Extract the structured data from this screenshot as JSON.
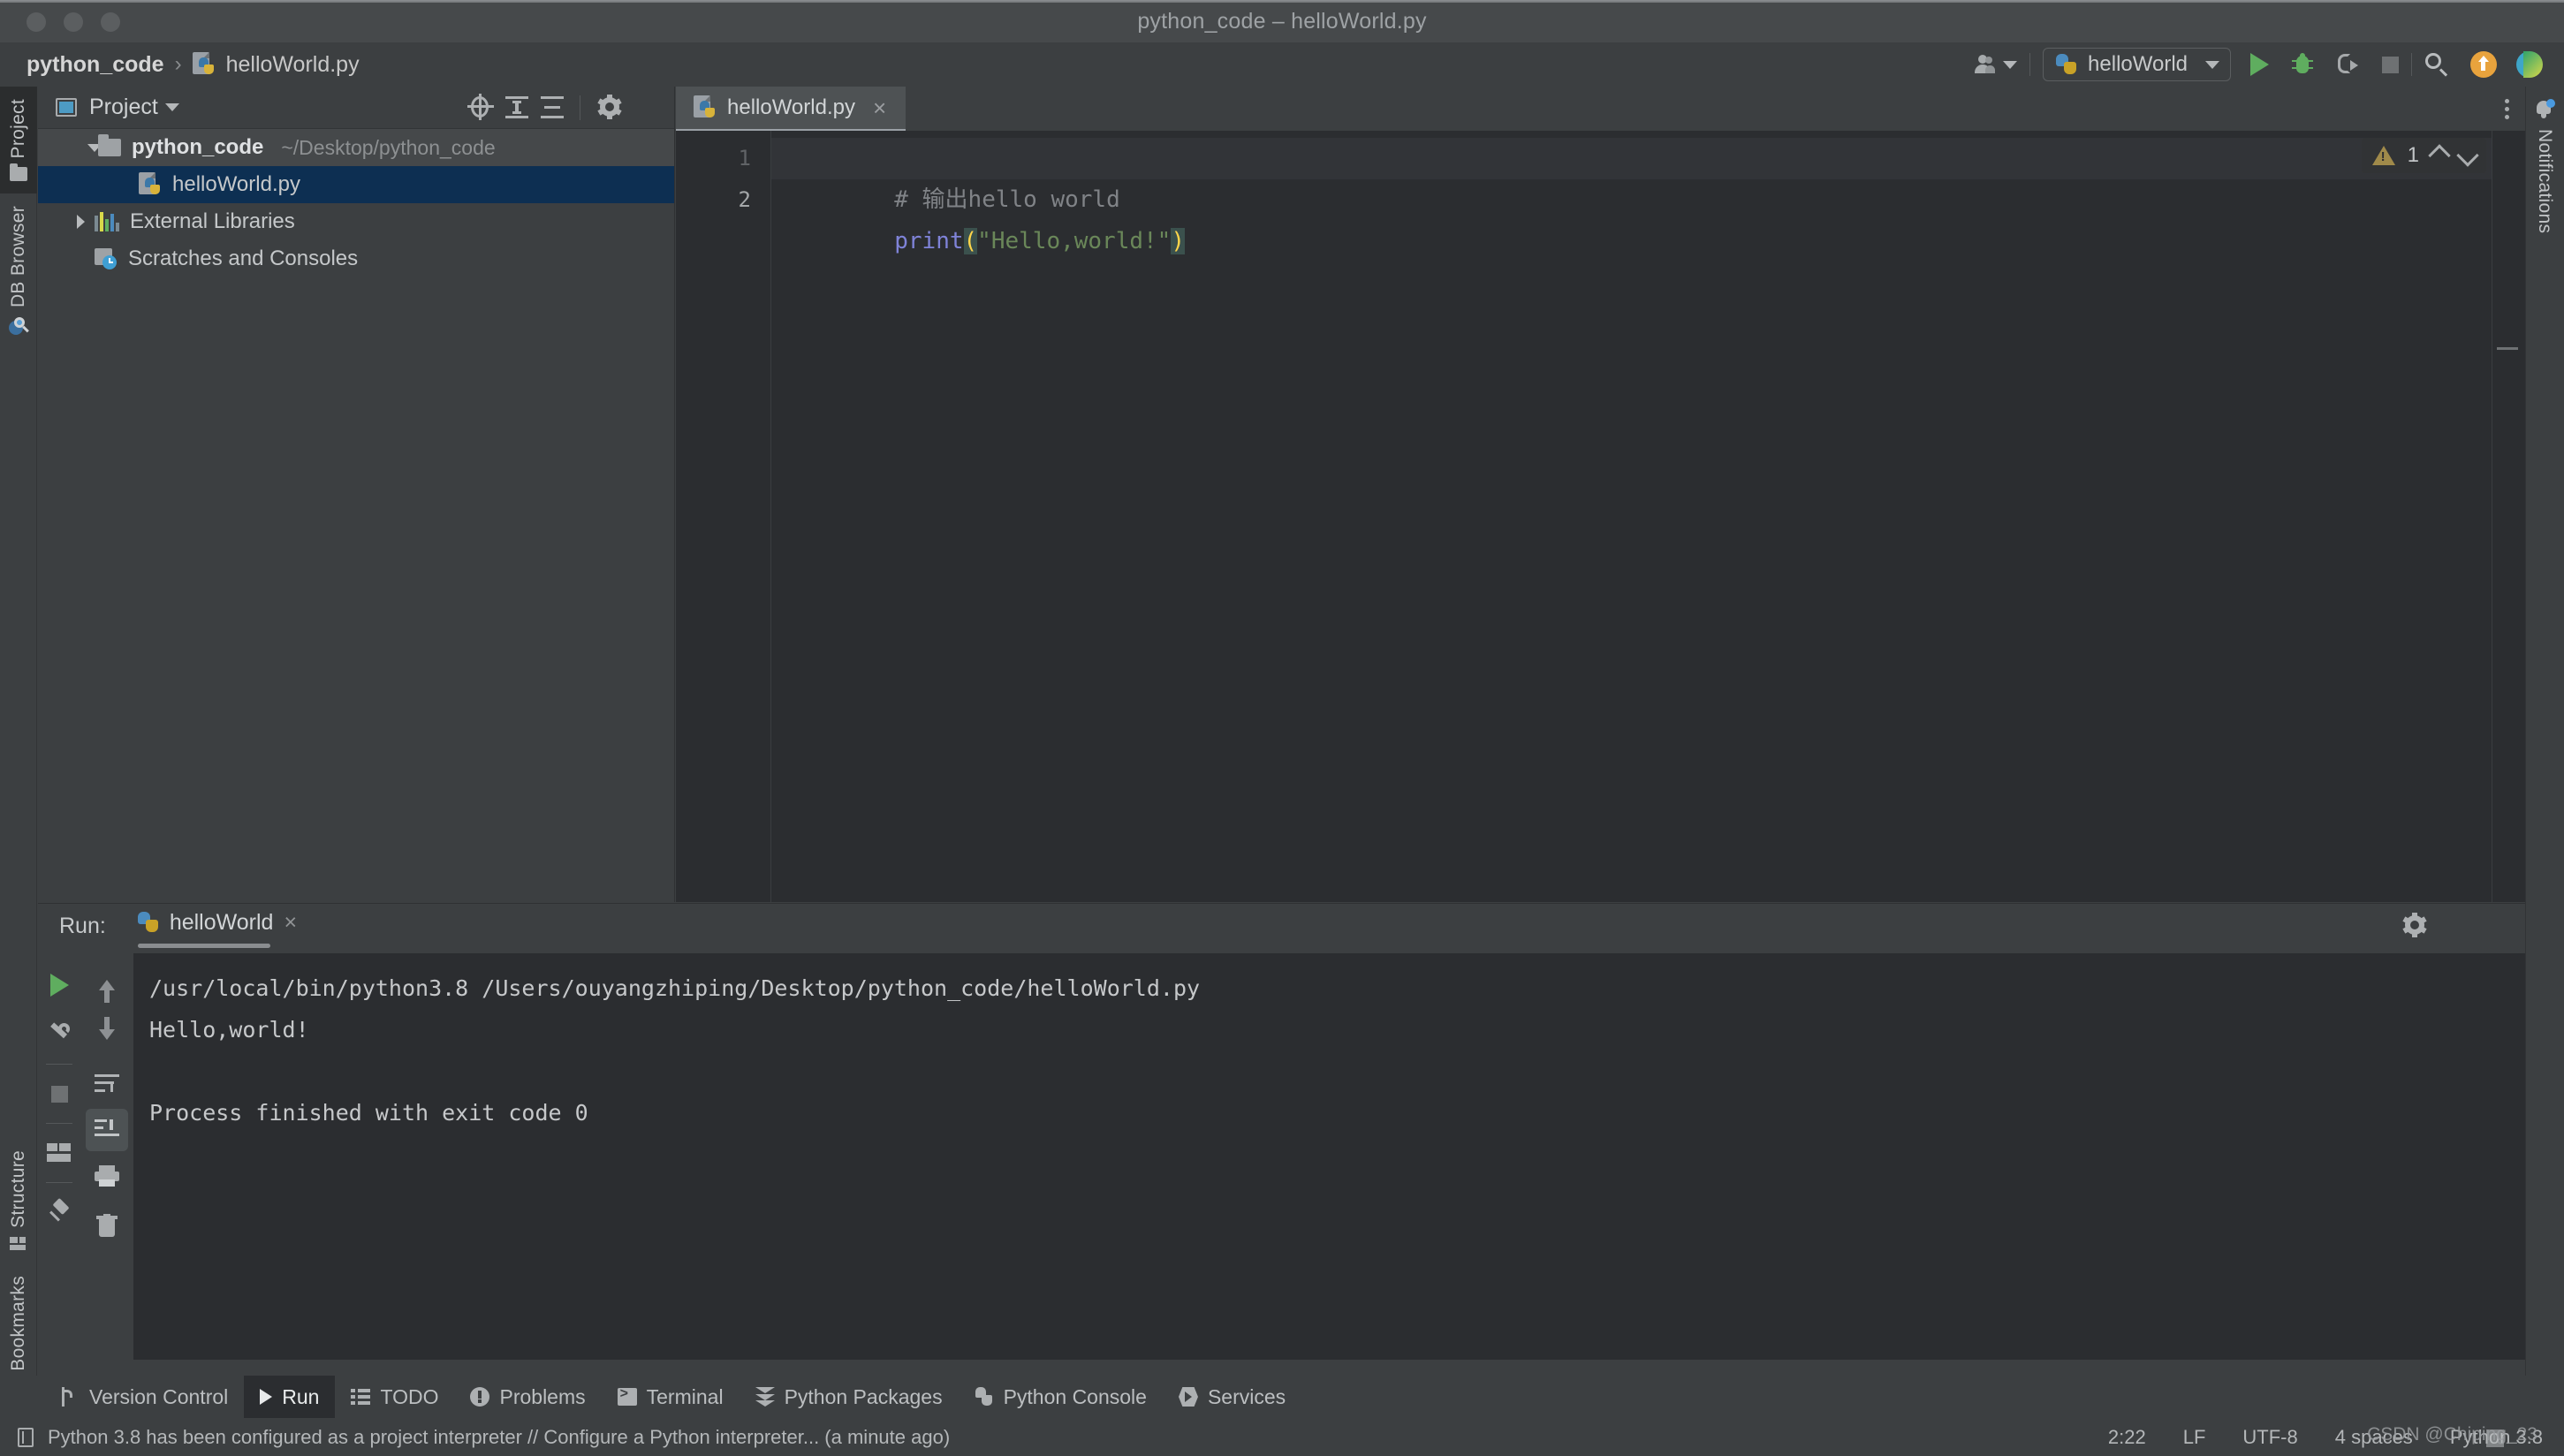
{
  "window": {
    "title": "python_code – helloWorld.py",
    "traffic_lights": [
      "close",
      "minimize",
      "zoom"
    ]
  },
  "breadcrumb": {
    "project": "python_code",
    "separator": "›",
    "file": "helloWorld.py",
    "file_icon": "python-file-icon"
  },
  "top_toolbar": {
    "user_icon": "user-avatar-icon",
    "user_caret": "chevron-down-icon",
    "run_config": {
      "icon": "python-icon",
      "name": "helloWorld",
      "caret": "chevron-down-icon"
    },
    "buttons": [
      {
        "name": "run-button",
        "icon": "play-icon",
        "color": "#5fad5f"
      },
      {
        "name": "debug-button",
        "icon": "bug-icon",
        "color": "#5fad5f"
      },
      {
        "name": "run-coverage-button",
        "icon": "coverage-icon",
        "color": "#a6a9ab"
      },
      {
        "name": "stop-button",
        "icon": "stop-square-icon",
        "color": "#6e7173"
      },
      {
        "name": "search-everywhere-button",
        "icon": "search-icon",
        "color": "#b9bcbe"
      },
      {
        "name": "update-project-button",
        "icon": "arrow-up-circle-icon",
        "color": "#e8a33d"
      },
      {
        "name": "ide-logo",
        "icon": "pycharm-logo-icon",
        "color": "#3ea6c9"
      }
    ]
  },
  "left_rail": {
    "top": [
      {
        "label": "Project",
        "icon": "folder-icon",
        "active": true
      },
      {
        "label": "DB Browser",
        "icon": "db-browser-icon",
        "active": false
      }
    ],
    "bottom": [
      {
        "label": "Structure",
        "icon": "structure-icon",
        "active": false
      },
      {
        "label": "Bookmarks",
        "icon": "bookmark-icon",
        "active": false
      }
    ]
  },
  "right_rail": {
    "items": [
      {
        "label": "Notifications",
        "icon": "bell-icon",
        "badge": true
      }
    ]
  },
  "project_panel": {
    "title": "Project",
    "title_caret": "chevron-down-icon",
    "header_icons": [
      {
        "name": "select-opened-file-button",
        "icon": "locate-icon"
      },
      {
        "name": "expand-all-button",
        "icon": "expand-all-icon"
      },
      {
        "name": "collapse-all-button",
        "icon": "collapse-all-icon"
      },
      {
        "name": "panel-settings-button",
        "icon": "gear-icon"
      },
      {
        "name": "hide-panel-button",
        "icon": "minus-icon"
      }
    ],
    "tree": [
      {
        "label": "python_code",
        "path": "~/Desktop/python_code",
        "icon": "folder-icon",
        "arrow": "chevron-down-icon",
        "kind": "root",
        "selected": false
      },
      {
        "label": "helloWorld.py",
        "path": "",
        "icon": "python-file-icon",
        "arrow": "",
        "kind": "file",
        "selected": true
      },
      {
        "label": "External Libraries",
        "path": "",
        "icon": "libraries-icon",
        "arrow": "chevron-right-icon",
        "kind": "node",
        "selected": false
      },
      {
        "label": "Scratches and Consoles",
        "path": "",
        "icon": "scratches-icon",
        "arrow": "",
        "kind": "node",
        "selected": false
      }
    ]
  },
  "editor": {
    "tab": {
      "label": "helloWorld.py",
      "icon": "python-file-icon",
      "close": "×"
    },
    "options_icon": "kebab-menu-icon",
    "inspection": {
      "warning_icon": "warning-triangle-icon",
      "count": "1",
      "prev": "chevron-up-icon",
      "next": "chevron-down-icon"
    },
    "lines": [
      {
        "number": "1",
        "tokens": [
          {
            "text": "# 输出hello world",
            "type": "comment"
          }
        ]
      },
      {
        "number": "2",
        "tokens": [
          {
            "text": "print",
            "type": "function"
          },
          {
            "text": "(",
            "type": "paren-highlight"
          },
          {
            "text": "\"Hello,world!\"",
            "type": "string"
          },
          {
            "text": ")",
            "type": "paren-highlight"
          }
        ]
      }
    ]
  },
  "run_panel": {
    "label": "Run:",
    "tab": {
      "label": "helloWorld",
      "icon": "python-icon",
      "close": "×"
    },
    "header_icons": [
      {
        "name": "run-settings-button",
        "icon": "gear-icon"
      },
      {
        "name": "hide-run-panel-button",
        "icon": "minus-icon"
      }
    ],
    "gutter_left": [
      {
        "name": "rerun-button",
        "icon": "play-icon",
        "active": false
      },
      {
        "name": "modify-run-configuration-button",
        "icon": "wrench-icon",
        "active": false
      },
      {
        "name": "stop-process-button",
        "icon": "stop-square-icon",
        "active": false
      },
      {
        "name": "layout-settings-button",
        "icon": "layout-icon",
        "active": false
      },
      {
        "name": "pin-tab-button",
        "icon": "pin-icon",
        "active": false
      }
    ],
    "gutter_right": [
      {
        "name": "previous-occurrence-button",
        "icon": "arrow-up-icon",
        "active": false
      },
      {
        "name": "next-occurrence-button",
        "icon": "arrow-down-icon",
        "active": false
      },
      {
        "name": "soft-wrap-button",
        "icon": "soft-wrap-icon",
        "active": false
      },
      {
        "name": "scroll-to-end-button",
        "icon": "scroll-to-end-icon",
        "active": true
      },
      {
        "name": "print-button",
        "icon": "printer-icon",
        "active": false
      },
      {
        "name": "clear-all-button",
        "icon": "trash-icon",
        "active": false
      }
    ],
    "console": [
      "/usr/local/bin/python3.8 /Users/ouyangzhiping/Desktop/python_code/helloWorld.py",
      "Hello,world!",
      "",
      "Process finished with exit code 0"
    ]
  },
  "bottom_bar": {
    "items": [
      {
        "label": "Version Control",
        "icon": "version-control-icon",
        "active": false
      },
      {
        "label": "Run",
        "icon": "run-icon",
        "active": true
      },
      {
        "label": "TODO",
        "icon": "todo-icon",
        "active": false
      },
      {
        "label": "Problems",
        "icon": "problems-icon",
        "active": false
      },
      {
        "label": "Terminal",
        "icon": "terminal-icon",
        "active": false
      },
      {
        "label": "Python Packages",
        "icon": "python-packages-icon",
        "active": false
      },
      {
        "label": "Python Console",
        "icon": "python-console-icon",
        "active": false
      },
      {
        "label": "Services",
        "icon": "services-icon",
        "active": false
      }
    ]
  },
  "status_bar": {
    "message_icon": "notification-log-icon",
    "message": "Python 3.8 has been configured as a project interpreter // Configure a Python interpreter... (a minute ago)",
    "caret_position": "2:22",
    "line_separator": "LF",
    "encoding": "UTF-8",
    "indent": "4 spaces",
    "interpreter": "Python 3.8",
    "watermark": "CSDN @Chiping_23"
  }
}
